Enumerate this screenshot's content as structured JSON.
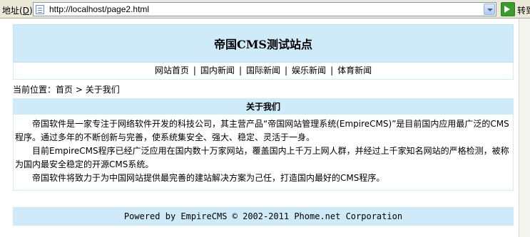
{
  "browser": {
    "address_label_prefix": "地址(",
    "address_label_key": "D",
    "address_label_suffix": ")",
    "url": "http://localhost/page2.html",
    "go_label": "转到",
    "icons": {
      "page": "page-icon",
      "dropdown": "chevron-down-icon",
      "go": "go-arrow-icon"
    }
  },
  "site": {
    "title": "帝国CMS测试站点",
    "nav": [
      {
        "label": "网站首页"
      },
      {
        "label": "国内新闻"
      },
      {
        "label": "国际新闻"
      },
      {
        "label": "娱乐新闻"
      },
      {
        "label": "体育新闻"
      }
    ],
    "nav_separator": "|"
  },
  "breadcrumb": {
    "prefix": "当前位置：",
    "home": "首页",
    "separator": ">",
    "current": "关于我们"
  },
  "content": {
    "heading": "关于我们",
    "paragraphs": [
      "帝国软件是一家专注于网络软件开发的科技公司，其主营产品“帝国网站管理系统(EmpireCMS)”是目前国内应用最广泛的CMS程序。通过多年的不断创新与完善，使系统集安全、强大、稳定、灵活于一身。",
      "目前EmpireCMS程序已经广泛应用在国内数十万家网站，覆盖国内上千万上网人群，并经过上千家知名网站的严格检测，被称为国内最安全稳定的开源CMS系统。",
      "帝国软件将致力于为中国网站提供最完善的建站解决方案为己任，打造国内最好的CMS程序。"
    ]
  },
  "footer": {
    "text": "Powered by EmpireCMS © 2002-2011 Phome.net Corporation"
  },
  "colors": {
    "header_bg": "#cfeaf8",
    "border": "#cfeaf8"
  }
}
